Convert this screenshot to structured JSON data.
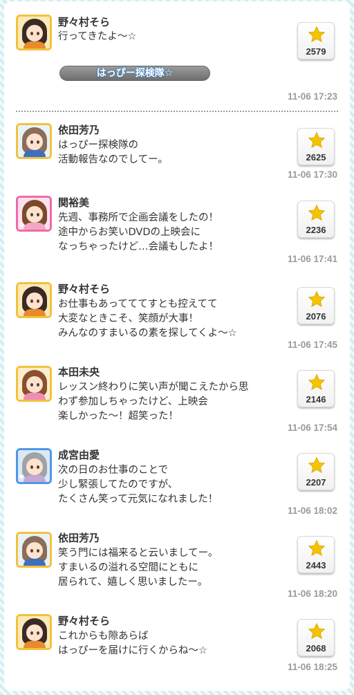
{
  "tag_label": "はっぴー探検隊☆",
  "posts": [
    {
      "name": "野々村そら",
      "lines": [
        "行ってきたよ〜☆"
      ],
      "stars": "2579",
      "time": "11-06 17:23"
    },
    {
      "name": "依田芳乃",
      "lines": [
        "はっぴー探検隊の",
        "活動報告なのでしてー。"
      ],
      "stars": "2625",
      "time": "11-06 17:30"
    },
    {
      "name": "関裕美",
      "lines": [
        "先週、事務所で企画会議をしたの！",
        "途中からお笑いDVDの上映会に",
        "なっちゃったけど…会議もしたよ！"
      ],
      "stars": "2236",
      "time": "11-06 17:41"
    },
    {
      "name": "野々村そら",
      "lines": [
        "お仕事もあってててすとも控えてて",
        "大変なときこそ、笑顔が大事！",
        "みんなのすまいるの素を探してくよ〜☆"
      ],
      "stars": "2076",
      "time": "11-06 17:45"
    },
    {
      "name": "本田未央",
      "lines": [
        "レッスン終わりに笑い声が聞こえたから思",
        "わず参加しちゃったけど、上映会",
        "楽しかった〜！超笑った！"
      ],
      "stars": "2146",
      "time": "11-06 17:54"
    },
    {
      "name": "成宮由愛",
      "lines": [
        "次の日のお仕事のことで",
        "少し緊張してたのですが、",
        "たくさん笑って元気になれました！"
      ],
      "stars": "2207",
      "time": "11-06 18:02"
    },
    {
      "name": "依田芳乃",
      "lines": [
        "笑う門には福来ると云いましてー。",
        "すまいるの溢れる空間にともに",
        "居られて、嬉しく思いましたー。"
      ],
      "stars": "2443",
      "time": "11-06 18:20"
    },
    {
      "name": "野々村そら",
      "lines": [
        "これからも隙あらば",
        "はっぴーを届けに行くからね〜☆"
      ],
      "stars": "2068",
      "time": "11-06 18:25"
    }
  ],
  "icons": {
    "like": "star-icon",
    "avatar": "idol-portrait"
  },
  "colors": {
    "star": "#f5c400",
    "time": "#9a9a9a",
    "tag_glow": "#2c7fc8",
    "frame_gold": "#f2c23c",
    "frame_pink": "#f06aa8",
    "frame_blue": "#4d97e6"
  }
}
